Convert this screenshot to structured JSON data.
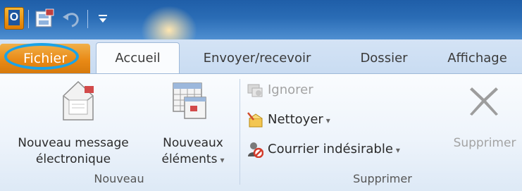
{
  "quick_access": {
    "app_icon_letter": "O",
    "icons": [
      "outlook-icon",
      "save-icon",
      "undo-icon",
      "customize-icon"
    ]
  },
  "tabs": {
    "file": "Fichier",
    "items": [
      "Accueil",
      "Envoyer/recevoir",
      "Dossier",
      "Affichage"
    ],
    "active": "Accueil"
  },
  "groups": {
    "nouveau": {
      "label": "Nouveau",
      "new_message_line1": "Nouveau message",
      "new_message_line2": "électronique",
      "new_items_line1": "Nouveaux",
      "new_items_line2": "éléments"
    },
    "supprimer": {
      "label": "Supprimer",
      "ignore": "Ignorer",
      "clean": "Nettoyer",
      "junk": "Courrier indésirable",
      "delete": "Supprimer"
    }
  },
  "colors": {
    "file_tab": "#e98a16",
    "highlight_ring": "#1aa3e8",
    "title_bar": "#2a6cb5"
  }
}
